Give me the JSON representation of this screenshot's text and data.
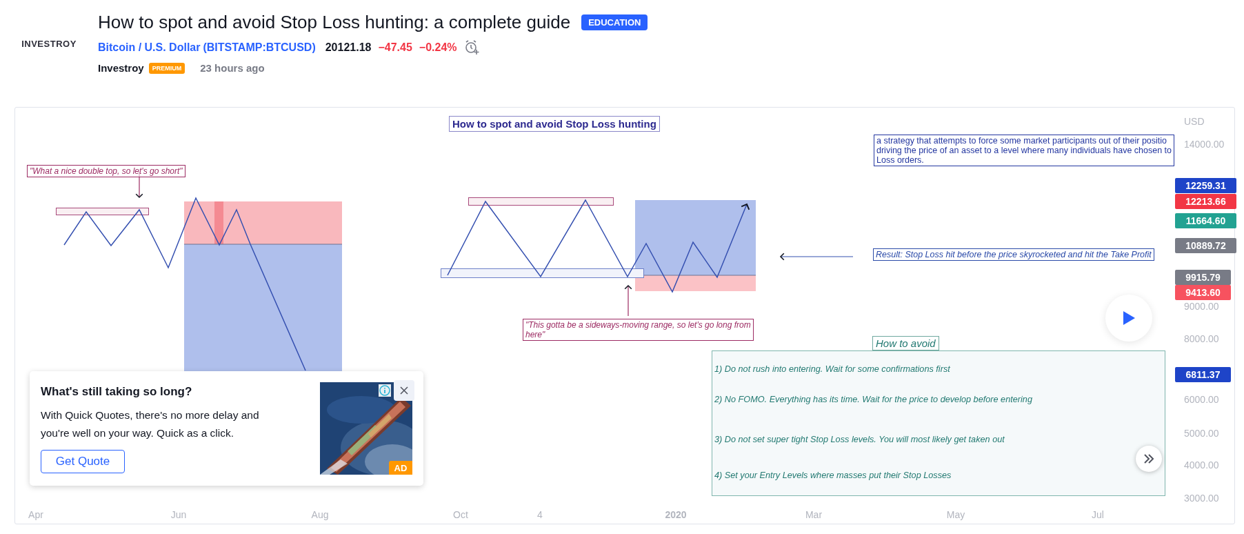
{
  "post": {
    "logo": "INVESTROY",
    "title": "How to spot and avoid Stop Loss hunting: a complete guide",
    "category": "EDUCATION",
    "symbol_name": "Bitcoin / U.S. Dollar",
    "symbol_ticker": "(BITSTAMP:BTCUSD)",
    "price": "20121.18",
    "change": "−47.45",
    "change_pct": "−0.24%",
    "author": "Investroy",
    "author_badge": "PREMIUM",
    "time": "23 hours ago"
  },
  "chart": {
    "title": "How to spot and avoid Stop Loss hunting",
    "notes": [
      {
        "kind": "quote",
        "lines": [
          "\"What a nice double top, so let's go short\""
        ]
      },
      {
        "kind": "quote",
        "lines": [
          "\"This gotta be a sideways-moving range, so let's go long from",
          "here\""
        ]
      },
      {
        "kind": "definition",
        "lines": [
          "a strategy that attempts to force some market participants out of their positio",
          "driving the price of an asset to a level where many individuals have chosen to",
          "Loss orders."
        ]
      },
      {
        "kind": "result",
        "lines": [
          "Result: Stop Loss hit before the price skyrocketed and hit the Take Profit"
        ]
      }
    ],
    "avoid": {
      "title": "How to avoid",
      "items": [
        "1) Do not rush into entering. Wait for some confirmations first",
        "2) No FOMO. Everything has its time. Wait for the price to develop before entering",
        "3) Do not set super tight Stop Loss levels. You will most likely get taken out",
        "4) Set your Entry Levels where masses put their Stop Losses"
      ]
    },
    "currency": "USD",
    "price_axis": [
      "14000.00",
      "9000.00",
      "8000.00",
      "6000.00",
      "5000.00",
      "4000.00",
      "3000.00"
    ],
    "price_tags": [
      {
        "text": "12259.31",
        "color": "#1e44c8"
      },
      {
        "text": "12213.66",
        "color": "#f23645"
      },
      {
        "text": "11664.60",
        "color": "#22a292"
      },
      {
        "text": "10889.72",
        "color": "#787b86"
      },
      {
        "text": "9915.79",
        "color": "#787b86"
      },
      {
        "text": "9413.60",
        "color": "#f7525f"
      },
      {
        "text": "6811.37",
        "color": "#1e44c8"
      }
    ],
    "time_axis": [
      {
        "text": "Apr",
        "bold": false
      },
      {
        "text": "Jun",
        "bold": false
      },
      {
        "text": "Aug",
        "bold": false
      },
      {
        "text": "Oct",
        "bold": false
      },
      {
        "text": "4",
        "bold": false
      },
      {
        "text": "2020",
        "bold": true
      },
      {
        "text": "Mar",
        "bold": false
      },
      {
        "text": "May",
        "bold": false
      },
      {
        "text": "Jul",
        "bold": false
      }
    ]
  },
  "ad": {
    "title": "What's still taking so long?",
    "body": "With Quick Quotes, there's no more delay and you're well on your way. Quick as a click.",
    "button": "Get Quote",
    "badge": "AD"
  }
}
